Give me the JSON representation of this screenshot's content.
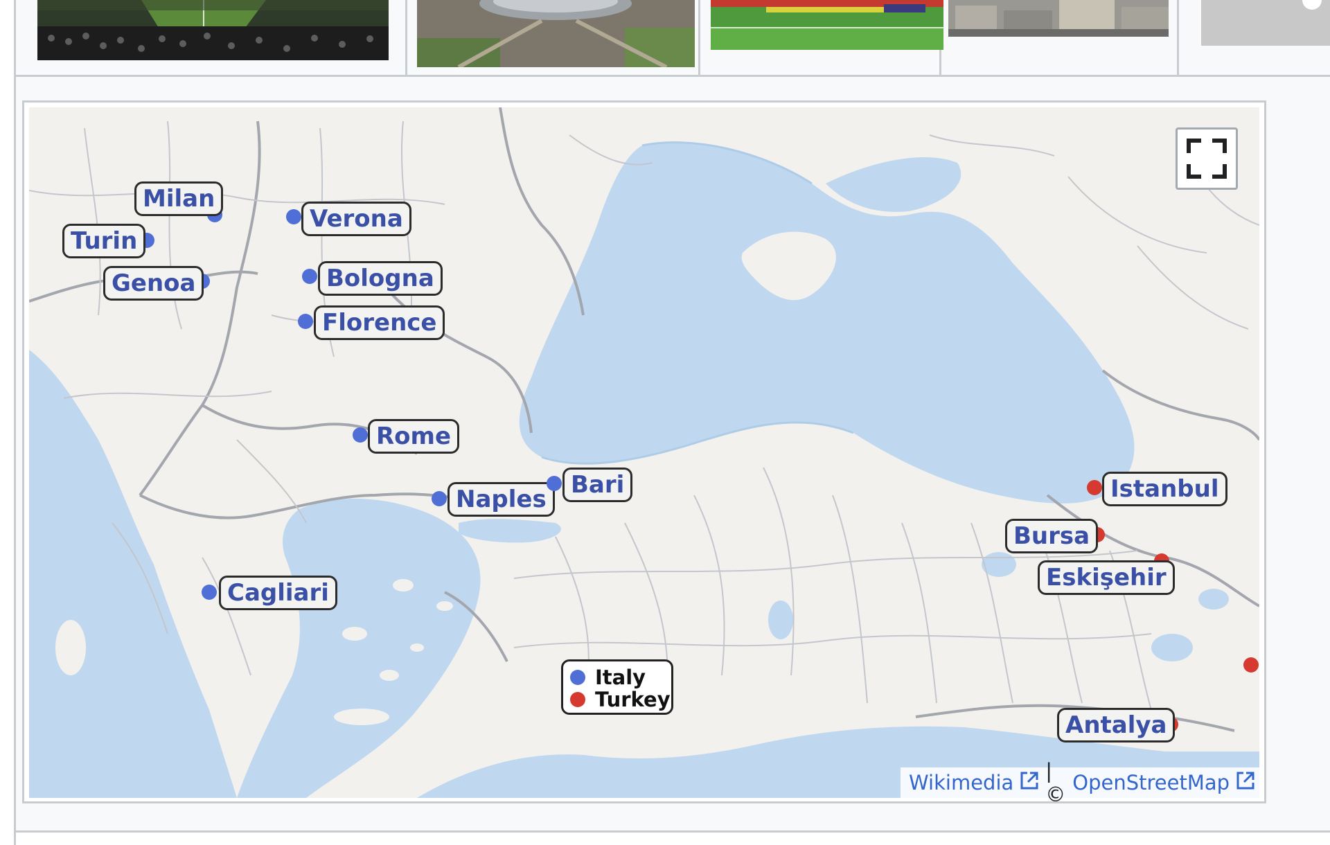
{
  "gallery": {
    "images": [
      {
        "icon": "stadium-crowd-photo"
      },
      {
        "icon": "stadium-aerial-photo"
      },
      {
        "icon": "stadium-pitch-photo"
      },
      {
        "icon": "city-buildings-photo"
      },
      {
        "icon": "placeholder-photo"
      }
    ]
  },
  "map": {
    "colors": {
      "italy": "#4f6fd6",
      "turkey": "#d6392f",
      "sea": "#bfd7ef",
      "land": "#f3f1ee"
    },
    "markers": [
      {
        "label": "Milan",
        "group": "italy"
      },
      {
        "label": "Verona",
        "group": "italy"
      },
      {
        "label": "Turin",
        "group": "italy"
      },
      {
        "label": "Bologna",
        "group": "italy"
      },
      {
        "label": "Genoa",
        "group": "italy"
      },
      {
        "label": "Florence",
        "group": "italy"
      },
      {
        "label": "Rome",
        "group": "italy"
      },
      {
        "label": "Naples",
        "group": "italy"
      },
      {
        "label": "Bari",
        "group": "italy"
      },
      {
        "label": "Cagliari",
        "group": "italy"
      },
      {
        "label": "Istanbul",
        "group": "turkey"
      },
      {
        "label": "Bursa",
        "group": "turkey"
      },
      {
        "label": "Eskişehir",
        "group": "turkey"
      },
      {
        "label": "Antalya",
        "group": "turkey"
      },
      {
        "label": "",
        "group": "turkey"
      }
    ],
    "legend": [
      {
        "label": "Italy",
        "group": "italy"
      },
      {
        "label": "Turkey",
        "group": "turkey"
      }
    ],
    "fullscreen_icon": "fullscreen-icon",
    "attribution": {
      "wikimedia": "Wikimedia",
      "separator": "| ©",
      "osm": "OpenStreetMap",
      "icon": "external-link-icon"
    }
  }
}
